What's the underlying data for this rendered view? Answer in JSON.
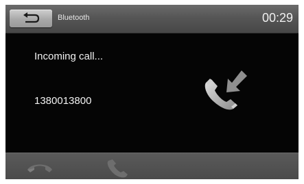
{
  "header": {
    "title": "Bluetooth",
    "time": "00:29",
    "back_icon": "back-arrow-icon"
  },
  "call": {
    "status": "Incoming call...",
    "number": "1380013800",
    "icon": "incoming-call-icon"
  },
  "footer": {
    "reject_icon": "hang-up-icon",
    "accept_icon": "answer-call-icon"
  }
}
